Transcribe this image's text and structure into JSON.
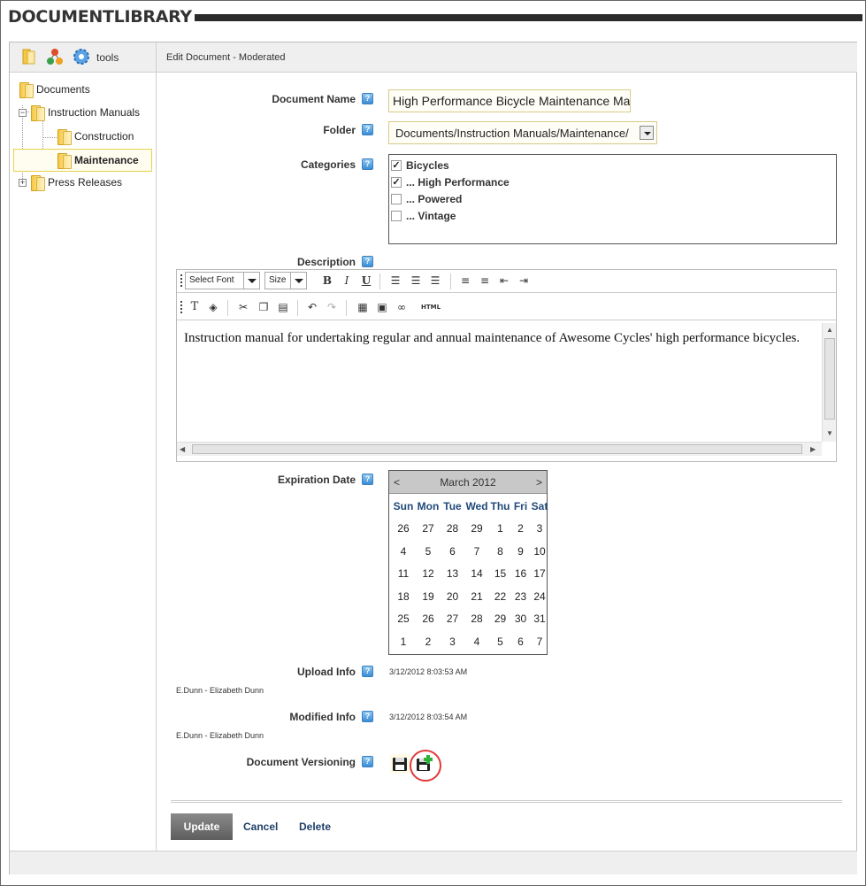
{
  "module": {
    "title": "DOCUMENTLIBRARY"
  },
  "toolbar": {
    "tools_label": "tools",
    "icons": [
      "folder-icon",
      "categories-icon",
      "tools-gear-icon"
    ]
  },
  "header": {
    "edit_title": "Edit Document  - Moderated"
  },
  "tree": {
    "root": "Documents",
    "items": [
      {
        "label": "Instruction Manuals",
        "expander": "−"
      },
      {
        "label": "Construction"
      },
      {
        "label": "Maintenance",
        "selected": true
      },
      {
        "label": "Press Releases",
        "expander": "+"
      }
    ]
  },
  "form": {
    "document_name_label": "Document Name",
    "document_name_value": "High Performance Bicycle Maintenance Man",
    "folder_label": "Folder",
    "folder_value": "Documents/Instruction Manuals/Maintenance/",
    "categories_label": "Categories",
    "categories": [
      {
        "label": "Bicycles",
        "checked": true,
        "mark": "✓"
      },
      {
        "label": "... High Performance",
        "checked": true,
        "mark": "✓"
      },
      {
        "label": "... Powered",
        "checked": false,
        "mark": ""
      },
      {
        "label": "... Vintage",
        "checked": false,
        "mark": ""
      }
    ],
    "description_label": "Description",
    "editor": {
      "font_select": "Select Font",
      "size_select": "Size",
      "bold": "B",
      "italic": "I",
      "underline": "U",
      "html_button": "HTML",
      "content": "Instruction manual for undertaking regular and annual maintenance of Awesome Cycles' high performance bicycles."
    },
    "expiration_label": "Expiration Date",
    "calendar": {
      "title": "March 2012",
      "prev": "<",
      "next": ">",
      "days_of_week": [
        "Sun",
        "Mon",
        "Tue",
        "Wed",
        "Thu",
        "Fri",
        "Sat"
      ],
      "weeks": [
        [
          "26",
          "27",
          "28",
          "29",
          "1",
          "2",
          "3"
        ],
        [
          "4",
          "5",
          "6",
          "7",
          "8",
          "9",
          "10"
        ],
        [
          "11",
          "12",
          "13",
          "14",
          "15",
          "16",
          "17"
        ],
        [
          "18",
          "19",
          "20",
          "21",
          "22",
          "23",
          "24"
        ],
        [
          "25",
          "26",
          "27",
          "28",
          "29",
          "30",
          "31"
        ],
        [
          "1",
          "2",
          "3",
          "4",
          "5",
          "6",
          "7"
        ]
      ]
    },
    "upload_label": "Upload Info",
    "upload_date": "3/12/2012 8:03:53 AM",
    "upload_user": "E.Dunn -  Elizabeth Dunn",
    "modified_label": "Modified Info",
    "modified_date": "3/12/2012 8:03:54 AM",
    "modified_user": "E.Dunn -  Elizabeth Dunn",
    "versioning_label": "Document Versioning"
  },
  "actions": {
    "update": "Update",
    "cancel": "Cancel",
    "delete": "Delete"
  },
  "colors": {
    "accent_link": "#1f3f6a",
    "help_icon": "#3b8dd6",
    "highlight_circle": "#e03a3a"
  }
}
